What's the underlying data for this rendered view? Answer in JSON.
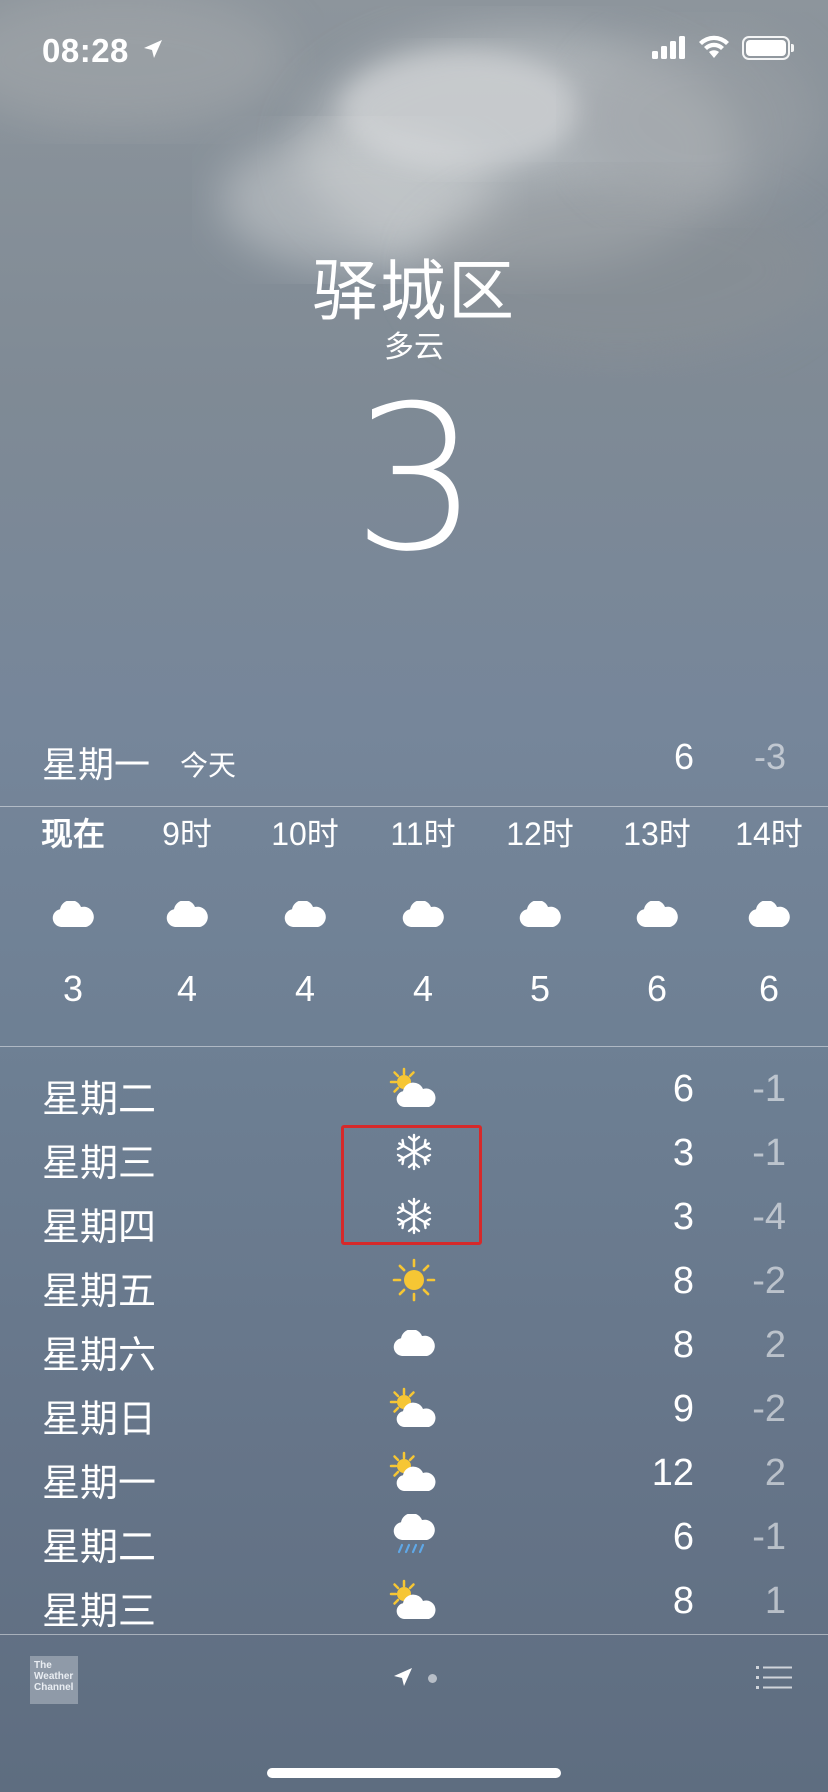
{
  "status_bar": {
    "time": "08:28",
    "location_icon": "location-arrow-icon",
    "signal_icon": "cellular-signal-icon",
    "wifi_icon": "wifi-icon",
    "battery_icon": "battery-icon"
  },
  "header": {
    "city": "驿城区",
    "condition": "多云",
    "temperature": "3"
  },
  "today": {
    "day": "星期一",
    "label": "今天",
    "high": "6",
    "low": "-3"
  },
  "hourly": [
    {
      "time": "现在",
      "icon": "cloud-icon",
      "temp": "3"
    },
    {
      "time": "9时",
      "icon": "cloud-icon",
      "temp": "4"
    },
    {
      "time": "10时",
      "icon": "cloud-icon",
      "temp": "4"
    },
    {
      "time": "11时",
      "icon": "cloud-icon",
      "temp": "4"
    },
    {
      "time": "12时",
      "icon": "cloud-icon",
      "temp": "5"
    },
    {
      "time": "13时",
      "icon": "cloud-icon",
      "temp": "6"
    },
    {
      "time": "14时",
      "icon": "cloud-icon",
      "temp": "6"
    }
  ],
  "daily": [
    {
      "day": "星期二",
      "icon": "partly-sunny-icon",
      "high": "6",
      "low": "-1"
    },
    {
      "day": "星期三",
      "icon": "snowflake-icon",
      "high": "3",
      "low": "-1"
    },
    {
      "day": "星期四",
      "icon": "snowflake-icon",
      "high": "3",
      "low": "-4"
    },
    {
      "day": "星期五",
      "icon": "sun-icon",
      "high": "8",
      "low": "-2"
    },
    {
      "day": "星期六",
      "icon": "cloud-icon",
      "high": "8",
      "low": "2"
    },
    {
      "day": "星期日",
      "icon": "partly-sunny-icon",
      "high": "9",
      "low": "-2"
    },
    {
      "day": "星期一",
      "icon": "partly-sunny-icon",
      "high": "12",
      "low": "2"
    },
    {
      "day": "星期二",
      "icon": "rain-icon",
      "high": "6",
      "low": "-1"
    },
    {
      "day": "星期三",
      "icon": "partly-sunny-icon",
      "high": "8",
      "low": "1"
    }
  ],
  "bottom_bar": {
    "logo_lines": [
      "The",
      "Weather",
      "Channel"
    ],
    "location_page_icon": "location-arrow-icon",
    "list_icon": "list-icon"
  },
  "colors": {
    "highlight_box": "#d6292a",
    "sun": "#f6c634",
    "rain": "#5fa8e8"
  }
}
